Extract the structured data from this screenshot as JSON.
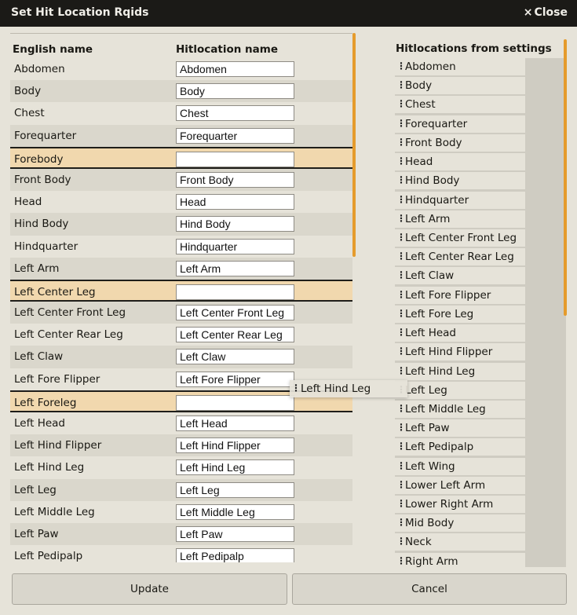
{
  "window": {
    "title": "Set Hit Location Rqids",
    "close_label": "Close",
    "close_icon": "×"
  },
  "left": {
    "col_english": "English name",
    "col_hitloc": "Hitlocation name",
    "rows": [
      {
        "en": "Abdomen",
        "val": "Abdomen",
        "missing": false
      },
      {
        "en": "Body",
        "val": "Body",
        "missing": false
      },
      {
        "en": "Chest",
        "val": "Chest",
        "missing": false
      },
      {
        "en": "Forequarter",
        "val": "Forequarter",
        "missing": false
      },
      {
        "en": "Forebody",
        "val": "",
        "missing": true
      },
      {
        "en": "Front Body",
        "val": "Front Body",
        "missing": false
      },
      {
        "en": "Head",
        "val": "Head",
        "missing": false
      },
      {
        "en": "Hind Body",
        "val": "Hind Body",
        "missing": false
      },
      {
        "en": "Hindquarter",
        "val": "Hindquarter",
        "missing": false
      },
      {
        "en": "Left Arm",
        "val": "Left Arm",
        "missing": false
      },
      {
        "en": "Left Center Leg",
        "val": "",
        "missing": true
      },
      {
        "en": "Left Center Front Leg",
        "val": "Left Center Front Leg",
        "missing": false
      },
      {
        "en": "Left Center Rear Leg",
        "val": "Left Center Rear Leg",
        "missing": false
      },
      {
        "en": "Left Claw",
        "val": "Left Claw",
        "missing": false
      },
      {
        "en": "Left Fore Flipper",
        "val": "Left Fore Flipper",
        "missing": false
      },
      {
        "en": "Left Foreleg",
        "val": "",
        "missing": true
      },
      {
        "en": "Left Head",
        "val": "Left Head",
        "missing": false
      },
      {
        "en": "Left Hind Flipper",
        "val": "Left Hind Flipper",
        "missing": false
      },
      {
        "en": "Left Hind Leg",
        "val": "Left Hind Leg",
        "missing": false
      },
      {
        "en": "Left Leg",
        "val": "Left Leg",
        "missing": false
      },
      {
        "en": "Left Middle Leg",
        "val": "Left Middle Leg",
        "missing": false
      },
      {
        "en": "Left Paw",
        "val": "Left Paw",
        "missing": false
      },
      {
        "en": "Left Pedipalp",
        "val": "Left Pedipalp",
        "missing": false
      }
    ]
  },
  "right": {
    "header": "Hitlocations from settings",
    "items": [
      "Abdomen",
      "Body",
      "Chest",
      "Forequarter",
      "Front Body",
      "Head",
      "Hind Body",
      "Hindquarter",
      "Left Arm",
      "Left Center Front Leg",
      "Left Center Rear Leg",
      "Left Claw",
      "Left Fore Flipper",
      "Left Fore Leg",
      "Left Head",
      "Left Hind Flipper",
      "Left Hind Leg",
      "Left Leg",
      "Left Middle Leg",
      "Left Paw",
      "Left Pedipalp",
      "Left Wing",
      "Lower Left Arm",
      "Lower Right Arm",
      "Mid Body",
      "Neck",
      "Right Arm"
    ]
  },
  "drag_ghost": {
    "label": "Left Hind Leg"
  },
  "footer": {
    "update_label": "Update",
    "cancel_label": "Cancel"
  },
  "colors": {
    "accent": "#e59b2c",
    "missing_row": "#f1d8ae",
    "titlebar": "#1b1a17"
  }
}
